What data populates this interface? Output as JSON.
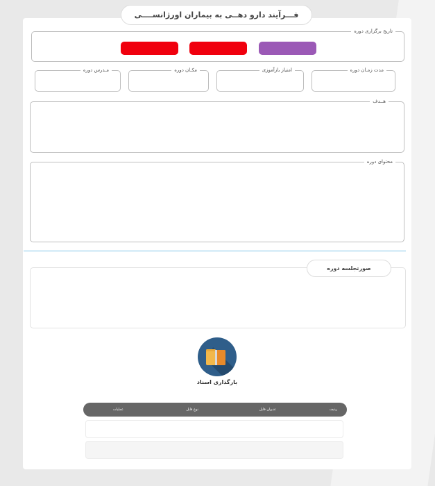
{
  "page": {
    "title": "فـــرآیند دارو دهــی به بیماران اورژانســــی"
  },
  "form": {
    "date_legend": "تاریخ برگزاری دوره",
    "duration_legend": "مدت زمـان دوره",
    "credit_legend": "امتیاز بازآموزی",
    "location_legend": "مکـان دوره",
    "instructor_legend": "مـدرس دوره",
    "goal_legend": "هــدف",
    "content_legend": "محتوای دوره",
    "button_colors": [
      "#9b59b6",
      "#f0000e",
      "#f0000e"
    ]
  },
  "minutes": {
    "title": "صورتجلسه دوره"
  },
  "upload": {
    "label": "بارگذاری اسناد"
  },
  "table": {
    "headers": {
      "row": "ردیف",
      "file_title": "عنـوان فایل",
      "file_type": "نوع فایل",
      "actions": "عملیات"
    }
  },
  "colors": {
    "accent_divider": "#7ec3e8",
    "table_header": "#666666"
  }
}
